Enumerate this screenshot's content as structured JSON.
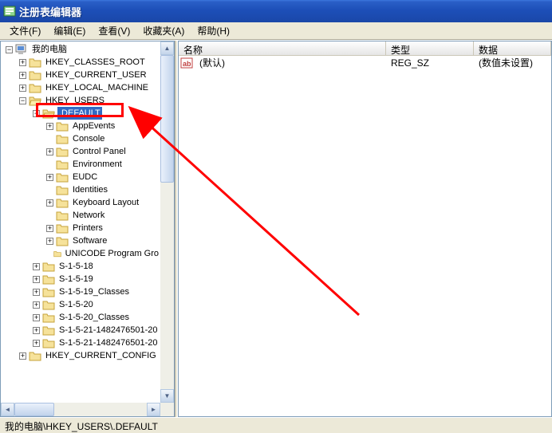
{
  "window": {
    "title": "注册表编辑器"
  },
  "menu": {
    "file": "文件(F)",
    "edit": "编辑(E)",
    "view": "查看(V)",
    "favorites": "收藏夹(A)",
    "help": "帮助(H)"
  },
  "tree": {
    "root": "我的电脑",
    "hkcr": "HKEY_CLASSES_ROOT",
    "hkcu": "HKEY_CURRENT_USER",
    "hklm": "HKEY_LOCAL_MACHINE",
    "hku": "HKEY_USERS",
    "def": ".DEFAULT",
    "children": {
      "appevents": "AppEvents",
      "console": "Console",
      "controlpanel": "Control Panel",
      "environment": "Environment",
      "eudc": "EUDC",
      "identities": "Identities",
      "keyboard": "Keyboard Layout",
      "network": "Network",
      "printers": "Printers",
      "software": "Software",
      "unicode": "UNICODE Program Gro"
    },
    "sids": {
      "s1": "S-1-5-18",
      "s2": "S-1-5-19",
      "s3": "S-1-5-19_Classes",
      "s4": "S-1-5-20",
      "s5": "S-1-5-20_Classes",
      "s6": "S-1-5-21-1482476501-20",
      "s7": "S-1-5-21-1482476501-20"
    },
    "hkcc": "HKEY_CURRENT_CONFIG"
  },
  "list": {
    "cols": {
      "name": "名称",
      "type": "类型",
      "data": "数据"
    },
    "row0": {
      "name": "(默认)",
      "type": "REG_SZ",
      "data": "(数值未设置)"
    }
  },
  "status": {
    "path": "我的电脑\\HKEY_USERS\\.DEFAULT"
  }
}
